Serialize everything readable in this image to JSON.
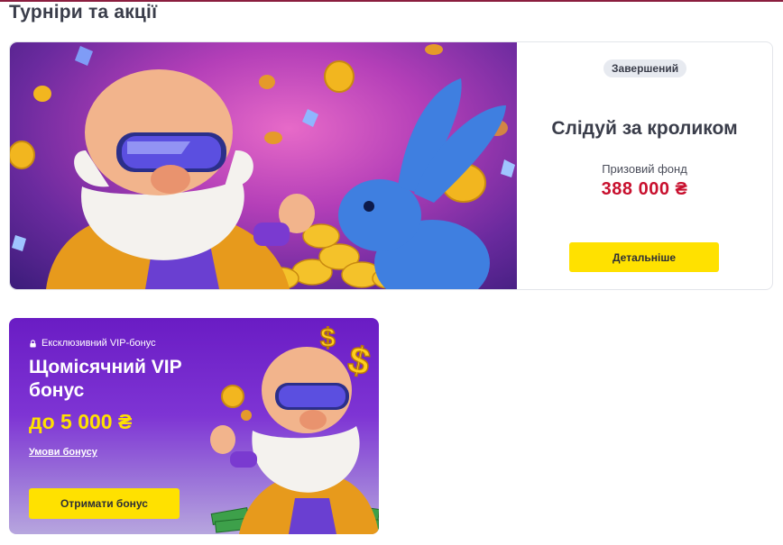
{
  "section": {
    "title": "Турніри та акції"
  },
  "tournament": {
    "status": "Завершений",
    "title": "Слідуй за кроликом",
    "prize_label": "Призовий фонд",
    "prize_value": "388 000 ₴",
    "details_label": "Детальніше"
  },
  "vip": {
    "tag": "Ексклюзивний VIP-бонус",
    "title": "Щомісячний VIP бонус",
    "amount": "до 5 000 ₴",
    "terms_link": "Умови бонусу",
    "button_label": "Отримати бонус"
  },
  "colors": {
    "accent_yellow": "#ffe100",
    "prize_red": "#c8102e",
    "vip_purple": "#6a1cc4"
  }
}
